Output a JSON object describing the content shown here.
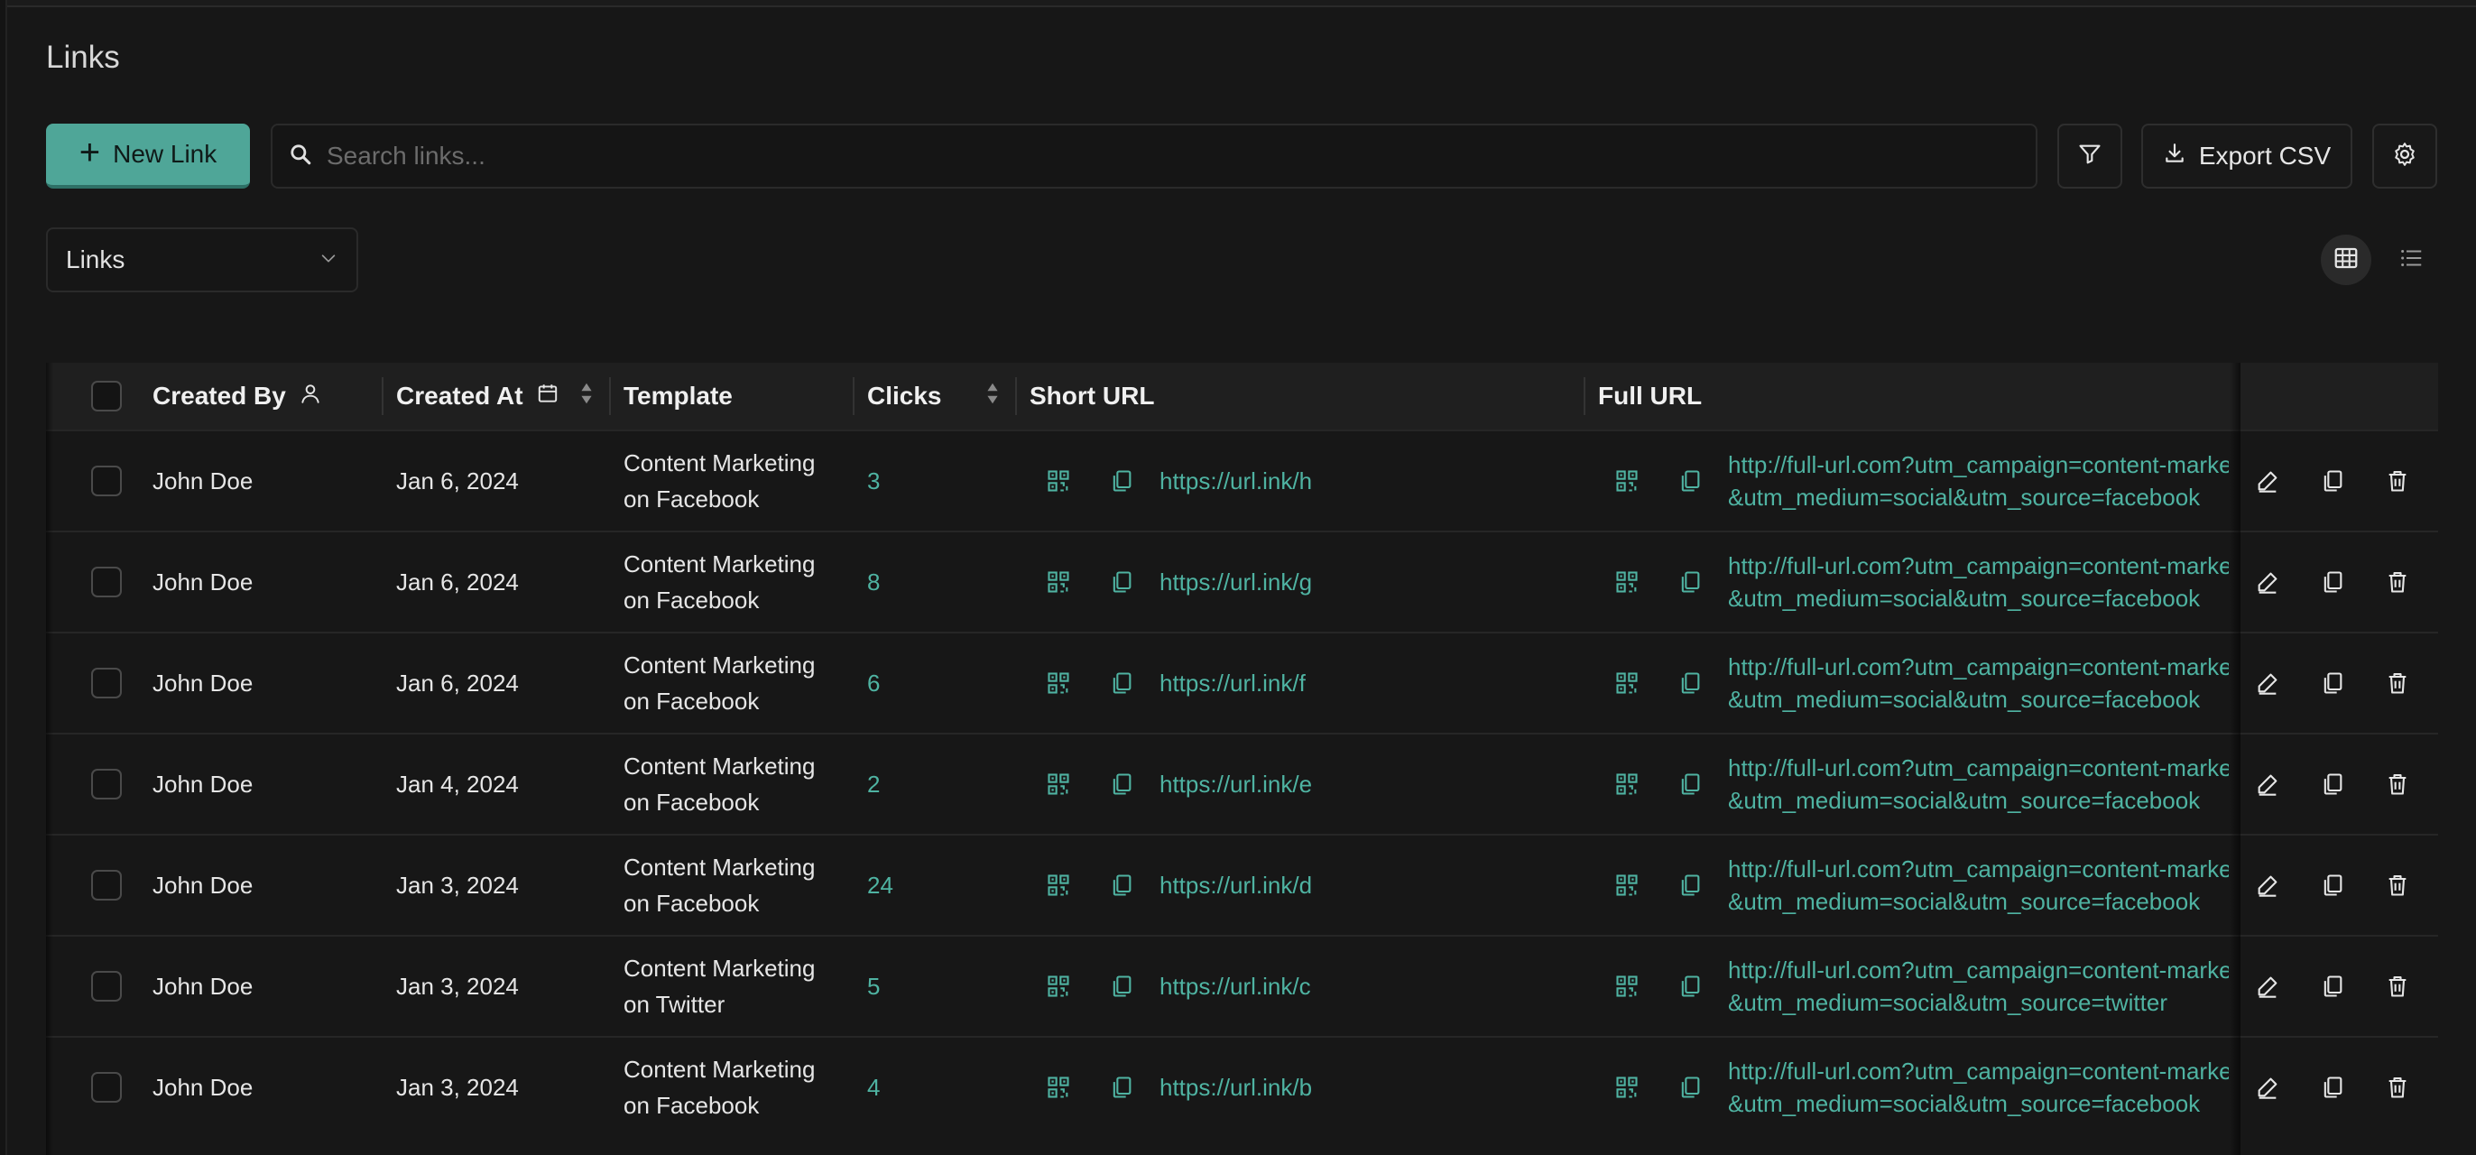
{
  "page": {
    "title": "Links"
  },
  "toolbar": {
    "new_link_label": "New Link",
    "search_placeholder": "Search links...",
    "export_label": "Export CSV"
  },
  "view_select": {
    "selected": "Links"
  },
  "table": {
    "headers": {
      "created_by": "Created By",
      "created_at": "Created At",
      "template": "Template",
      "clicks": "Clicks",
      "short_url": "Short URL",
      "full_url": "Full URL"
    },
    "rows": [
      {
        "created_by": "John Doe",
        "created_at": "Jan 6, 2024",
        "template_line1": "Content Marketing",
        "template_line2": "on Facebook",
        "clicks": "3",
        "short_url": "https://url.ink/h",
        "full_url_line1": "http://full-url.com?utm_campaign=content-market",
        "full_url_line2": "&utm_medium=social&utm_source=facebook"
      },
      {
        "created_by": "John Doe",
        "created_at": "Jan 6, 2024",
        "template_line1": "Content Marketing",
        "template_line2": "on Facebook",
        "clicks": "8",
        "short_url": "https://url.ink/g",
        "full_url_line1": "http://full-url.com?utm_campaign=content-market",
        "full_url_line2": "&utm_medium=social&utm_source=facebook"
      },
      {
        "created_by": "John Doe",
        "created_at": "Jan 6, 2024",
        "template_line1": "Content Marketing",
        "template_line2": "on Facebook",
        "clicks": "6",
        "short_url": "https://url.ink/f",
        "full_url_line1": "http://full-url.com?utm_campaign=content-market",
        "full_url_line2": "&utm_medium=social&utm_source=facebook"
      },
      {
        "created_by": "John Doe",
        "created_at": "Jan 4, 2024",
        "template_line1": "Content Marketing",
        "template_line2": "on Facebook",
        "clicks": "2",
        "short_url": "https://url.ink/e",
        "full_url_line1": "http://full-url.com?utm_campaign=content-market",
        "full_url_line2": "&utm_medium=social&utm_source=facebook"
      },
      {
        "created_by": "John Doe",
        "created_at": "Jan 3, 2024",
        "template_line1": "Content Marketing",
        "template_line2": "on Facebook",
        "clicks": "24",
        "short_url": "https://url.ink/d",
        "full_url_line1": "http://full-url.com?utm_campaign=content-market",
        "full_url_line2": "&utm_medium=social&utm_source=facebook"
      },
      {
        "created_by": "John Doe",
        "created_at": "Jan 3, 2024",
        "template_line1": "Content Marketing",
        "template_line2": "on Twitter",
        "clicks": "5",
        "short_url": "https://url.ink/c",
        "full_url_line1": "http://full-url.com?utm_campaign=content-market",
        "full_url_line2": "&utm_medium=social&utm_source=twitter"
      },
      {
        "created_by": "John Doe",
        "created_at": "Jan 3, 2024",
        "template_line1": "Content Marketing",
        "template_line2": "on Facebook",
        "clicks": "4",
        "short_url": "https://url.ink/b",
        "full_url_line1": "http://full-url.com?utm_campaign=content-market",
        "full_url_line2": "&utm_medium=social&utm_source=facebook"
      }
    ]
  },
  "colors": {
    "accent": "#4fa698",
    "link": "#4fb3a2",
    "background": "#171717"
  }
}
